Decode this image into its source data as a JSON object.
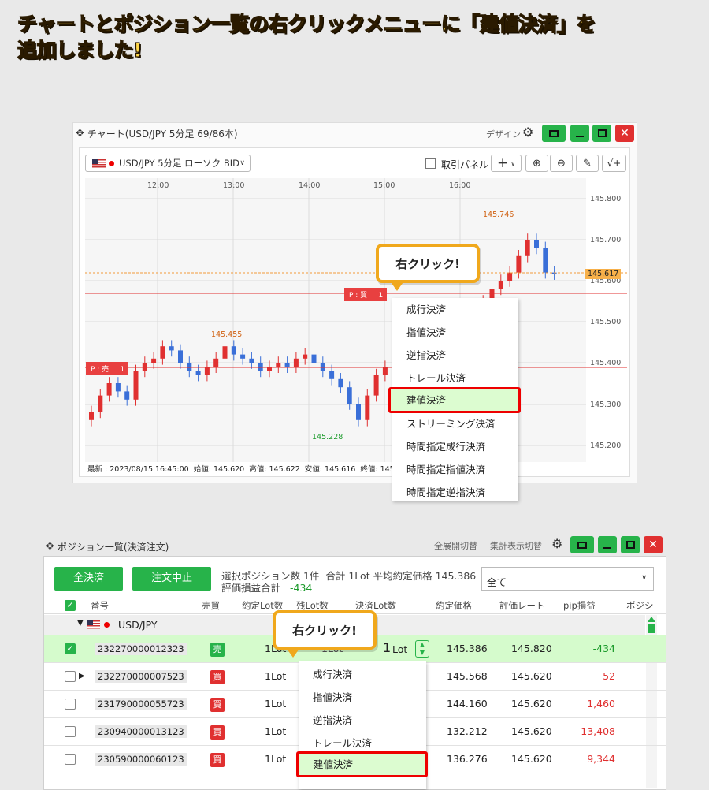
{
  "headline": {
    "line1": "チャートとポジション一覧の右クリックメニューに「建値決済」を",
    "line2": "追加しました!"
  },
  "chart_window": {
    "title": "チャート(USD/JPY 5分足 69/86本)",
    "design": "デザイン",
    "symbol_select": "USD/JPY 5分足 ローソク BID",
    "trade_panel": "取引パネル",
    "x_ticks": [
      "12:00",
      "13:00",
      "14:00",
      "15:00",
      "16:00"
    ],
    "y_ticks": [
      "145.800",
      "145.700",
      "145.600",
      "145.500",
      "145.400",
      "145.300",
      "145.200"
    ],
    "current_price": "145.617",
    "high_label": "145.746",
    "mid_high_label": "145.455",
    "low_label": "145.228",
    "position_buy": "P : 買     1",
    "position_sell": "P : 売     1",
    "status": "最新 : 2023/08/15 16:45:00  始値: 145.620  高値: 145.622  安値: 145.616  終値: 145.6"
  },
  "chart_data": {
    "type": "candlestick",
    "x_range": [
      "11:30",
      "16:45"
    ],
    "y_range": [
      145.17,
      145.84
    ],
    "annotations": [
      "145.746",
      "145.455",
      "145.228"
    ],
    "current": 145.617
  },
  "bubble_text": "右クリック!",
  "chart_menu": [
    "成行決済",
    "指値決済",
    "逆指決済",
    "トレール決済",
    "建値決済",
    "ストリーミング決済",
    "時間指定成行決済",
    "時間指定指値決済",
    "時間指定逆指決済"
  ],
  "pos_window": {
    "title": "ポジション一覧(決済注文)",
    "expand_all": "全展開切替",
    "total_toggle": "集計表示切替",
    "btn_all_settle": "全決済",
    "btn_cancel": "注文中止",
    "summary1": "選択ポジション数 1件  合計 1Lot 平均約定価格 145.386",
    "summary2_label": "評価損益合計",
    "summary2_value": "-434",
    "filter": "全て",
    "headers": [
      "番号",
      "売買",
      "約定Lot数",
      "残Lot数",
      "決済Lot数",
      "約定価格",
      "評価レート",
      "pip損益",
      "ポジシ"
    ],
    "group": "USD/JPY",
    "rows": [
      {
        "id": "232270000012323",
        "side": "売",
        "lot": "1Lot",
        "rem": "1Lot",
        "settle": "1",
        "price": "145.386",
        "rate": "145.820",
        "pl": "-434"
      },
      {
        "id": "232270000007523",
        "side": "買",
        "lot": "1Lot",
        "rem": "",
        "settle": "",
        "price": "145.568",
        "rate": "145.620",
        "pl": "52"
      },
      {
        "id": "231790000055723",
        "side": "買",
        "lot": "1Lot",
        "rem": "",
        "settle": "",
        "price": "144.160",
        "rate": "145.620",
        "pl": "1,460"
      },
      {
        "id": "230940000013123",
        "side": "買",
        "lot": "1Lot",
        "rem": "",
        "settle": "",
        "price": "132.212",
        "rate": "145.620",
        "pl": "13,408"
      },
      {
        "id": "230590000060123",
        "side": "買",
        "lot": "1Lot",
        "rem": "",
        "settle": "",
        "price": "136.276",
        "rate": "145.620",
        "pl": "9,344"
      }
    ],
    "settle_unit": "Lot"
  },
  "pos_menu": [
    "成行決済",
    "指値決済",
    "逆指決済",
    "トレール決済",
    "建値決済"
  ]
}
